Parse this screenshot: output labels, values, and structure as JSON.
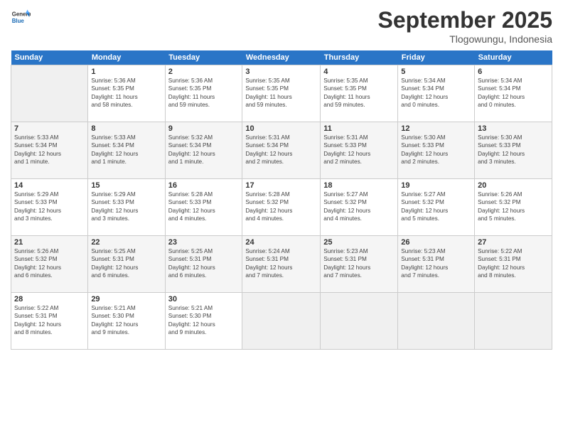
{
  "header": {
    "logo_general": "General",
    "logo_blue": "Blue",
    "month_title": "September 2025",
    "subtitle": "Tlogowungu, Indonesia"
  },
  "days_of_week": [
    "Sunday",
    "Monday",
    "Tuesday",
    "Wednesday",
    "Thursday",
    "Friday",
    "Saturday"
  ],
  "weeks": [
    [
      {
        "num": "",
        "info": ""
      },
      {
        "num": "1",
        "info": "Sunrise: 5:36 AM\nSunset: 5:35 PM\nDaylight: 11 hours\nand 58 minutes."
      },
      {
        "num": "2",
        "info": "Sunrise: 5:36 AM\nSunset: 5:35 PM\nDaylight: 11 hours\nand 59 minutes."
      },
      {
        "num": "3",
        "info": "Sunrise: 5:35 AM\nSunset: 5:35 PM\nDaylight: 11 hours\nand 59 minutes."
      },
      {
        "num": "4",
        "info": "Sunrise: 5:35 AM\nSunset: 5:35 PM\nDaylight: 11 hours\nand 59 minutes."
      },
      {
        "num": "5",
        "info": "Sunrise: 5:34 AM\nSunset: 5:34 PM\nDaylight: 12 hours\nand 0 minutes."
      },
      {
        "num": "6",
        "info": "Sunrise: 5:34 AM\nSunset: 5:34 PM\nDaylight: 12 hours\nand 0 minutes."
      }
    ],
    [
      {
        "num": "7",
        "info": "Sunrise: 5:33 AM\nSunset: 5:34 PM\nDaylight: 12 hours\nand 1 minute."
      },
      {
        "num": "8",
        "info": "Sunrise: 5:33 AM\nSunset: 5:34 PM\nDaylight: 12 hours\nand 1 minute."
      },
      {
        "num": "9",
        "info": "Sunrise: 5:32 AM\nSunset: 5:34 PM\nDaylight: 12 hours\nand 1 minute."
      },
      {
        "num": "10",
        "info": "Sunrise: 5:31 AM\nSunset: 5:34 PM\nDaylight: 12 hours\nand 2 minutes."
      },
      {
        "num": "11",
        "info": "Sunrise: 5:31 AM\nSunset: 5:33 PM\nDaylight: 12 hours\nand 2 minutes."
      },
      {
        "num": "12",
        "info": "Sunrise: 5:30 AM\nSunset: 5:33 PM\nDaylight: 12 hours\nand 2 minutes."
      },
      {
        "num": "13",
        "info": "Sunrise: 5:30 AM\nSunset: 5:33 PM\nDaylight: 12 hours\nand 3 minutes."
      }
    ],
    [
      {
        "num": "14",
        "info": "Sunrise: 5:29 AM\nSunset: 5:33 PM\nDaylight: 12 hours\nand 3 minutes."
      },
      {
        "num": "15",
        "info": "Sunrise: 5:29 AM\nSunset: 5:33 PM\nDaylight: 12 hours\nand 3 minutes."
      },
      {
        "num": "16",
        "info": "Sunrise: 5:28 AM\nSunset: 5:33 PM\nDaylight: 12 hours\nand 4 minutes."
      },
      {
        "num": "17",
        "info": "Sunrise: 5:28 AM\nSunset: 5:32 PM\nDaylight: 12 hours\nand 4 minutes."
      },
      {
        "num": "18",
        "info": "Sunrise: 5:27 AM\nSunset: 5:32 PM\nDaylight: 12 hours\nand 4 minutes."
      },
      {
        "num": "19",
        "info": "Sunrise: 5:27 AM\nSunset: 5:32 PM\nDaylight: 12 hours\nand 5 minutes."
      },
      {
        "num": "20",
        "info": "Sunrise: 5:26 AM\nSunset: 5:32 PM\nDaylight: 12 hours\nand 5 minutes."
      }
    ],
    [
      {
        "num": "21",
        "info": "Sunrise: 5:26 AM\nSunset: 5:32 PM\nDaylight: 12 hours\nand 6 minutes."
      },
      {
        "num": "22",
        "info": "Sunrise: 5:25 AM\nSunset: 5:31 PM\nDaylight: 12 hours\nand 6 minutes."
      },
      {
        "num": "23",
        "info": "Sunrise: 5:25 AM\nSunset: 5:31 PM\nDaylight: 12 hours\nand 6 minutes."
      },
      {
        "num": "24",
        "info": "Sunrise: 5:24 AM\nSunset: 5:31 PM\nDaylight: 12 hours\nand 7 minutes."
      },
      {
        "num": "25",
        "info": "Sunrise: 5:23 AM\nSunset: 5:31 PM\nDaylight: 12 hours\nand 7 minutes."
      },
      {
        "num": "26",
        "info": "Sunrise: 5:23 AM\nSunset: 5:31 PM\nDaylight: 12 hours\nand 7 minutes."
      },
      {
        "num": "27",
        "info": "Sunrise: 5:22 AM\nSunset: 5:31 PM\nDaylight: 12 hours\nand 8 minutes."
      }
    ],
    [
      {
        "num": "28",
        "info": "Sunrise: 5:22 AM\nSunset: 5:31 PM\nDaylight: 12 hours\nand 8 minutes."
      },
      {
        "num": "29",
        "info": "Sunrise: 5:21 AM\nSunset: 5:30 PM\nDaylight: 12 hours\nand 9 minutes."
      },
      {
        "num": "30",
        "info": "Sunrise: 5:21 AM\nSunset: 5:30 PM\nDaylight: 12 hours\nand 9 minutes."
      },
      {
        "num": "",
        "info": ""
      },
      {
        "num": "",
        "info": ""
      },
      {
        "num": "",
        "info": ""
      },
      {
        "num": "",
        "info": ""
      }
    ]
  ]
}
